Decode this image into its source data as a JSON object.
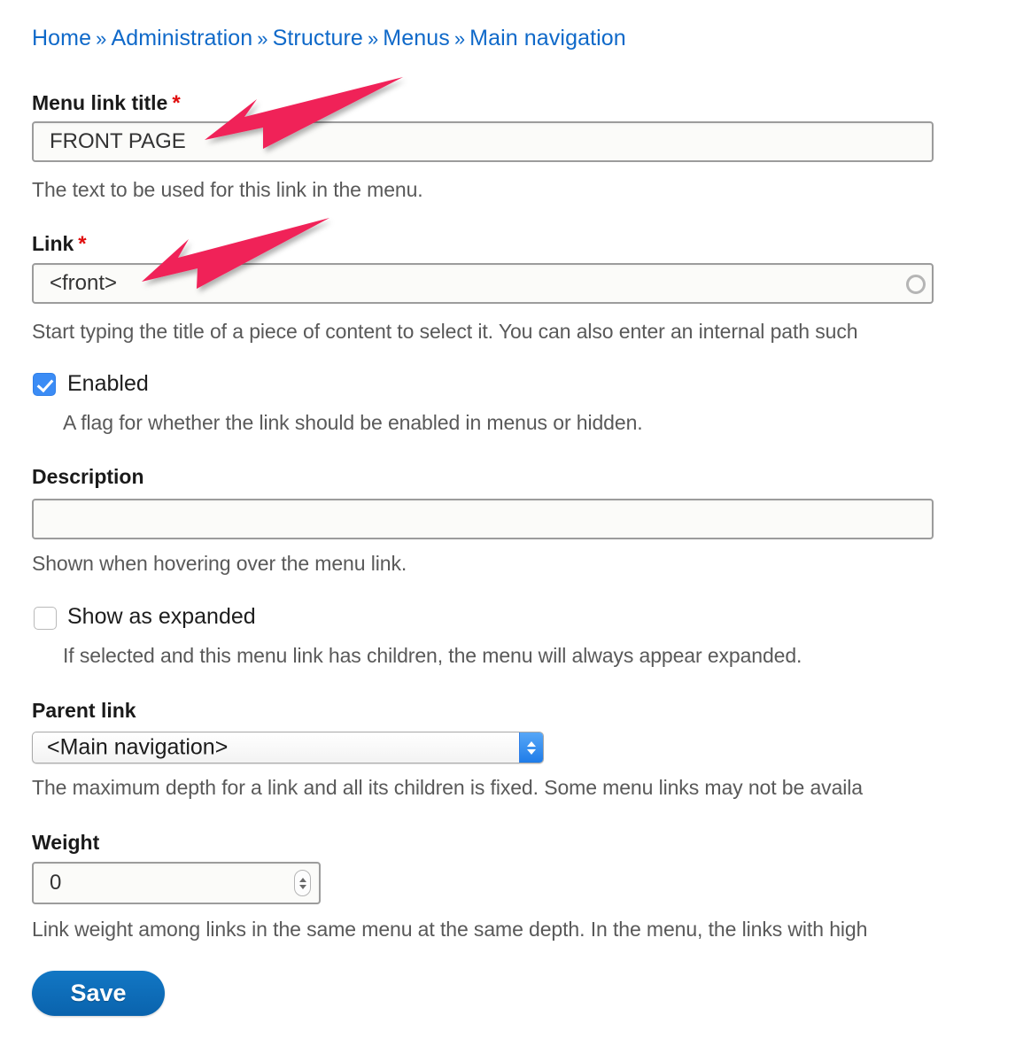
{
  "breadcrumb": {
    "separator": "»",
    "items": [
      {
        "label": "Home"
      },
      {
        "label": "Administration"
      },
      {
        "label": "Structure"
      },
      {
        "label": "Menus"
      },
      {
        "label": "Main navigation"
      }
    ]
  },
  "form": {
    "menu_link_title": {
      "label": "Menu link title",
      "required_marker": "*",
      "value": "FRONT PAGE",
      "description": "The text to be used for this link in the menu."
    },
    "link": {
      "label": "Link",
      "required_marker": "*",
      "value": "<front>",
      "description": "Start typing the title of a piece of content to select it. You can also enter an internal path such",
      "throbber_icon": "circle-throbber-icon"
    },
    "enabled": {
      "label": "Enabled",
      "checked": true,
      "description": "A flag for whether the link should be enabled in menus or hidden."
    },
    "description_field": {
      "label": "Description",
      "value": "",
      "placeholder": "",
      "description": "Shown when hovering over the menu link."
    },
    "show_as_expanded": {
      "label": "Show as expanded",
      "checked": false,
      "description": "If selected and this menu link has children, the menu will always appear expanded."
    },
    "parent_link": {
      "label": "Parent link",
      "selected": "<Main navigation>",
      "description": "The maximum depth for a link and all its children is fixed. Some menu links may not be availa"
    },
    "weight": {
      "label": "Weight",
      "value": "0",
      "description": "Link weight among links in the same menu at the same depth. In the menu, the links with high"
    },
    "save_button": {
      "label": "Save"
    }
  },
  "annotations": {
    "arrow_color": "#F02158",
    "arrows": [
      {
        "name": "arrow-to-menu-link-title-field"
      },
      {
        "name": "arrow-to-link-field"
      }
    ]
  },
  "colors": {
    "link_blue": "#0f69c9",
    "required_red": "#e00c0c",
    "accent_blue": "#0a63ad",
    "checkbox_blue": "#3b8cf5"
  }
}
